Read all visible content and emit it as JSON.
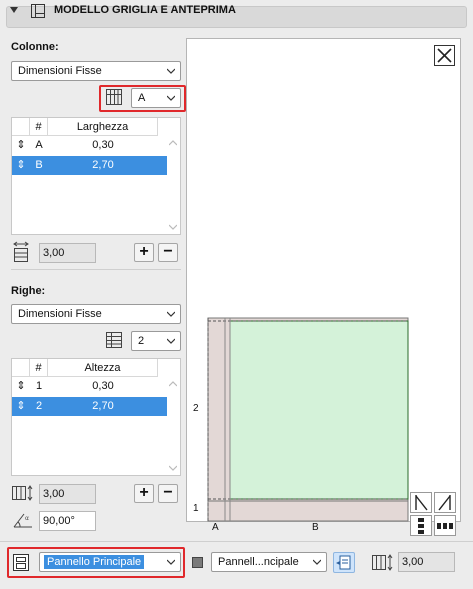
{
  "header": {
    "title": "MODELLO GRIGLIA E ANTEPRIMA"
  },
  "columns": {
    "label": "Colonne:",
    "mode_value": "Dimensioni Fisse",
    "selector_value": "A",
    "table": {
      "headers": [
        "#",
        "Larghezza"
      ],
      "rows": [
        {
          "id": "A",
          "value": "0,30",
          "selected": false
        },
        {
          "id": "B",
          "value": "2,70",
          "selected": true
        }
      ]
    },
    "total_value": "3,00",
    "add_label": "+",
    "remove_label": "−"
  },
  "rows": {
    "label": "Righe:",
    "mode_value": "Dimensioni Fisse",
    "count_value": "2",
    "table": {
      "headers": [
        "#",
        "Altezza"
      ],
      "rows": [
        {
          "id": "1",
          "value": "0,30",
          "selected": false
        },
        {
          "id": "2",
          "value": "2,70",
          "selected": true
        }
      ]
    },
    "total_value": "3,00",
    "add_label": "+",
    "remove_label": "−",
    "angle_value": "90,00°"
  },
  "preview": {
    "row_labels": [
      "2",
      "1"
    ],
    "col_labels": [
      "A",
      "B"
    ],
    "colors": {
      "panel_fill": "#d4f2d9",
      "frame_fill": "#e3d8d6",
      "panel_edge": "#2a6b2a"
    }
  },
  "bottom": {
    "panel_value": "Pannello Principale",
    "panel2_value": "Pannell...ncipale",
    "thickness_value": "3,00"
  },
  "colors": {
    "accent": "#3c8fe0",
    "highlight": "#e0282b"
  }
}
